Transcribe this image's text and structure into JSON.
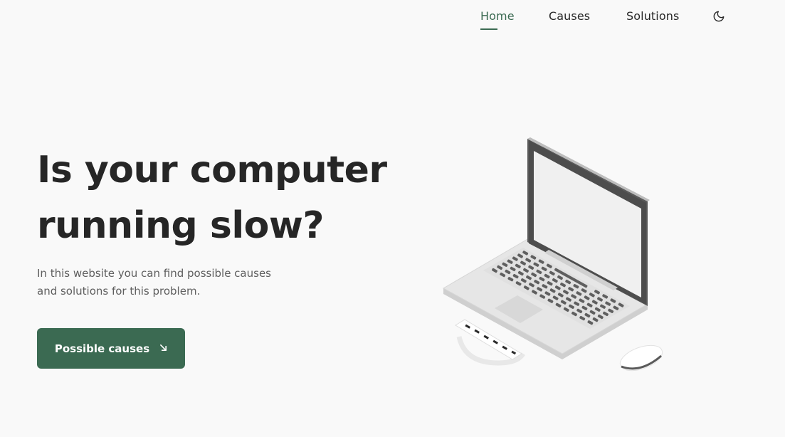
{
  "nav": {
    "items": [
      {
        "label": "Home",
        "active": true
      },
      {
        "label": "Causes",
        "active": false
      },
      {
        "label": "Solutions",
        "active": false
      }
    ],
    "theme_icon": "moon-icon"
  },
  "hero": {
    "title_line1": "Is your computer",
    "title_line2": "running slow?",
    "desc_line1": "In this website you can find possible causes",
    "desc_line2": "and solutions for this problem.",
    "cta_label": "Possible causes",
    "cta_icon": "arrow-down-right-icon"
  },
  "colors": {
    "accent": "#3b6a52",
    "background": "#f9f9f9",
    "text": "#262626",
    "muted": "#5e5e5e"
  },
  "illustration": {
    "icons": [
      "laptop-icon",
      "mouse-icon",
      "protractor-ruler-icon"
    ]
  }
}
